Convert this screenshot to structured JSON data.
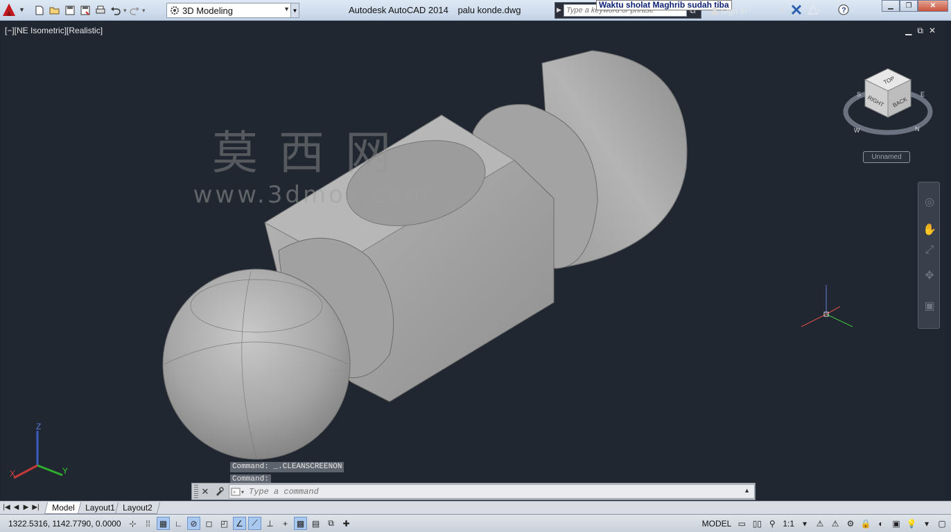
{
  "titlebar": {
    "workspace": "3D Modeling",
    "app_name": "Autodesk AutoCAD 2014",
    "file_name": "palu konde.dwg",
    "search_placeholder": "Type a keyword or phrase",
    "notification": "Waktu sholat Maghrib sudah tiba",
    "sign_in": "Sign In",
    "quick_access_icons": [
      "new-icon",
      "open-icon",
      "save-icon",
      "save-as-icon",
      "plot-icon",
      "undo-icon",
      "redo-icon"
    ]
  },
  "viewport": {
    "label": "[−][NE Isometric][Realistic]",
    "controls": [
      "▁",
      "⧉",
      "✕"
    ],
    "watermark_cn": "莫西网",
    "watermark_en": "www.3dmox.com",
    "viewcube": {
      "top": "TOP",
      "right": "RIGHT",
      "back": "BACK",
      "compass": [
        "S",
        "W",
        "N",
        "E"
      ],
      "ucs_menu": "Unnamed"
    },
    "ucs_axes": {
      "z": "Z",
      "x": "X",
      "y": "Y"
    }
  },
  "command": {
    "history": [
      "Command:  _.CLEANSCREENON",
      "Command:"
    ],
    "placeholder": "Type a command"
  },
  "layout_tabs": [
    {
      "label": "Model",
      "active": true
    },
    {
      "label": "Layout1",
      "active": false
    },
    {
      "label": "Layout2",
      "active": false
    }
  ],
  "statusbar": {
    "coordinates": "1322.5316, 1142.7790, 0.0000",
    "space": "MODEL",
    "annotation_scale": "1:1"
  },
  "colors": {
    "viewport_bg": "#212730",
    "model_gray": "#a9a9a9",
    "notification_text": "#0a1f73"
  }
}
